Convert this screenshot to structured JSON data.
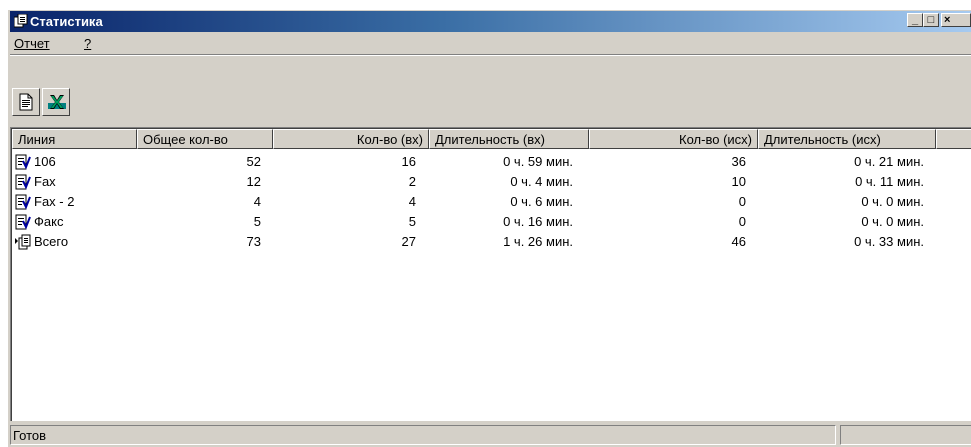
{
  "window": {
    "title": "Статистика",
    "controls": {
      "minimize": "_",
      "maximize": "□",
      "close": "×"
    }
  },
  "menu": {
    "report": "Отчет",
    "help": "?"
  },
  "toolbar": {
    "buttons": [
      {
        "name": "report",
        "icon": "report-page-icon"
      },
      {
        "name": "excel",
        "icon": "excel-icon"
      }
    ]
  },
  "table": {
    "columns": [
      "Линия",
      "Общее кол-во",
      "Кол-во (вх)",
      "Длительность (вх)",
      "Кол-во (исх)",
      "Длительность (исх)"
    ],
    "rows": [
      {
        "line": "106",
        "total": "52",
        "in_count": "16",
        "in_duration": "0 ч. 59 мин.",
        "out_count": "36",
        "out_duration": "0 ч. 21 мин.",
        "icon": "line-icon"
      },
      {
        "line": "Fax",
        "total": "12",
        "in_count": "2",
        "in_duration": "0 ч. 4 мин.",
        "out_count": "10",
        "out_duration": "0 ч. 11 мин.",
        "icon": "line-icon"
      },
      {
        "line": "Fax - 2",
        "total": "4",
        "in_count": "4",
        "in_duration": "0 ч. 6 мин.",
        "out_count": "0",
        "out_duration": "0 ч. 0 мин.",
        "icon": "line-icon"
      },
      {
        "line": "Факс",
        "total": "5",
        "in_count": "5",
        "in_duration": "0 ч. 16 мин.",
        "out_count": "0",
        "out_duration": "0 ч. 0 мин.",
        "icon": "line-icon"
      },
      {
        "line": "Всего",
        "total": "73",
        "in_count": "27",
        "in_duration": "1 ч. 26 мин.",
        "out_count": "46",
        "out_duration": "0 ч. 33 мин.",
        "icon": "total-icon"
      }
    ]
  },
  "status": {
    "text": "Готов"
  },
  "colors": {
    "titlebar_start": "#0a246a",
    "titlebar_end": "#a6caf0",
    "face": "#d4d0c8"
  }
}
